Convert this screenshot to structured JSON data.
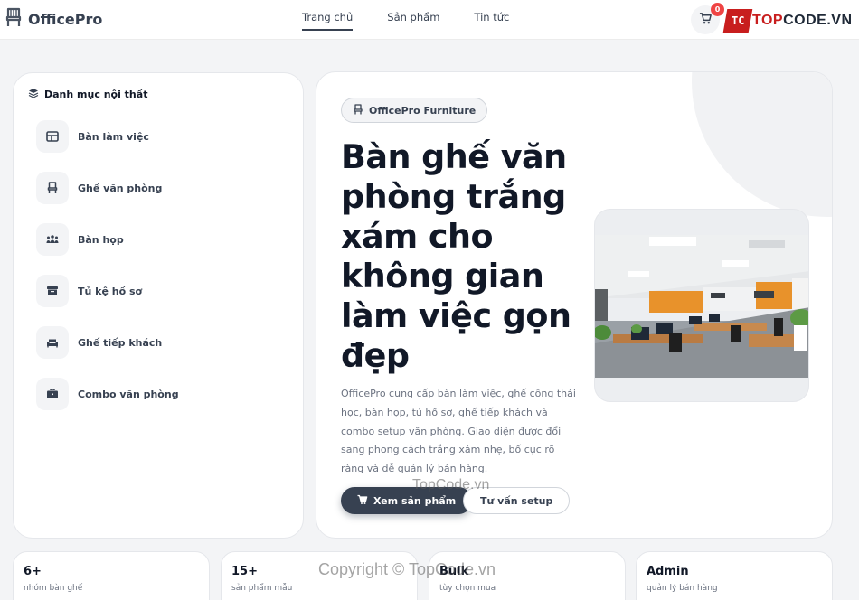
{
  "header": {
    "logo_text": "OfficePro",
    "nav": [
      {
        "label": "Trang chủ",
        "active": true
      },
      {
        "label": "Sản phẩm",
        "active": false
      },
      {
        "label": "Tin tức",
        "active": false
      }
    ],
    "cart_count": "0",
    "brand": {
      "mark": "TC",
      "text_part1": "TOP",
      "text_part2": "CODE.VN"
    }
  },
  "sidebar": {
    "title": "Danh mục nội thất",
    "items": [
      {
        "label": "Bàn làm việc",
        "icon": "table-icon"
      },
      {
        "label": "Ghế văn phòng",
        "icon": "chair-icon"
      },
      {
        "label": "Bàn họp",
        "icon": "people-icon"
      },
      {
        "label": "Tủ kệ hồ sơ",
        "icon": "archive-icon"
      },
      {
        "label": "Ghế tiếp khách",
        "icon": "couch-icon"
      },
      {
        "label": "Combo văn phòng",
        "icon": "briefcase-icon"
      }
    ]
  },
  "hero": {
    "pill": "OfficePro Furniture",
    "title": "Bàn ghế văn phòng trắng xám cho không gian làm việc gọn đẹp",
    "description": "OfficePro cung cấp bàn làm việc, ghế công thái học, bàn họp, tủ hồ sơ, ghế tiếp khách và combo setup văn phòng. Giao diện được đổi sang phong cách trắng xám nhẹ, bố cục rõ ràng và dễ quản lý bán hàng.",
    "primary_button": "Xem sản phẩm",
    "secondary_button": "Tư vấn setup"
  },
  "stats": [
    {
      "value": "6+",
      "label": "nhóm bàn ghế"
    },
    {
      "value": "15+",
      "label": "sản phẩm mẫu"
    },
    {
      "value": "Bulk",
      "label": "tùy chọn mua"
    },
    {
      "value": "Admin",
      "label": "quản lý bán hàng"
    }
  ],
  "watermarks": {
    "center": "TopCode.vn",
    "bottom": "Copyright © TopCode.vn"
  },
  "colors": {
    "primary": "#374151",
    "badge": "#ef4444",
    "brand_red": "#c81e1e",
    "background": "#f3f4f6"
  }
}
